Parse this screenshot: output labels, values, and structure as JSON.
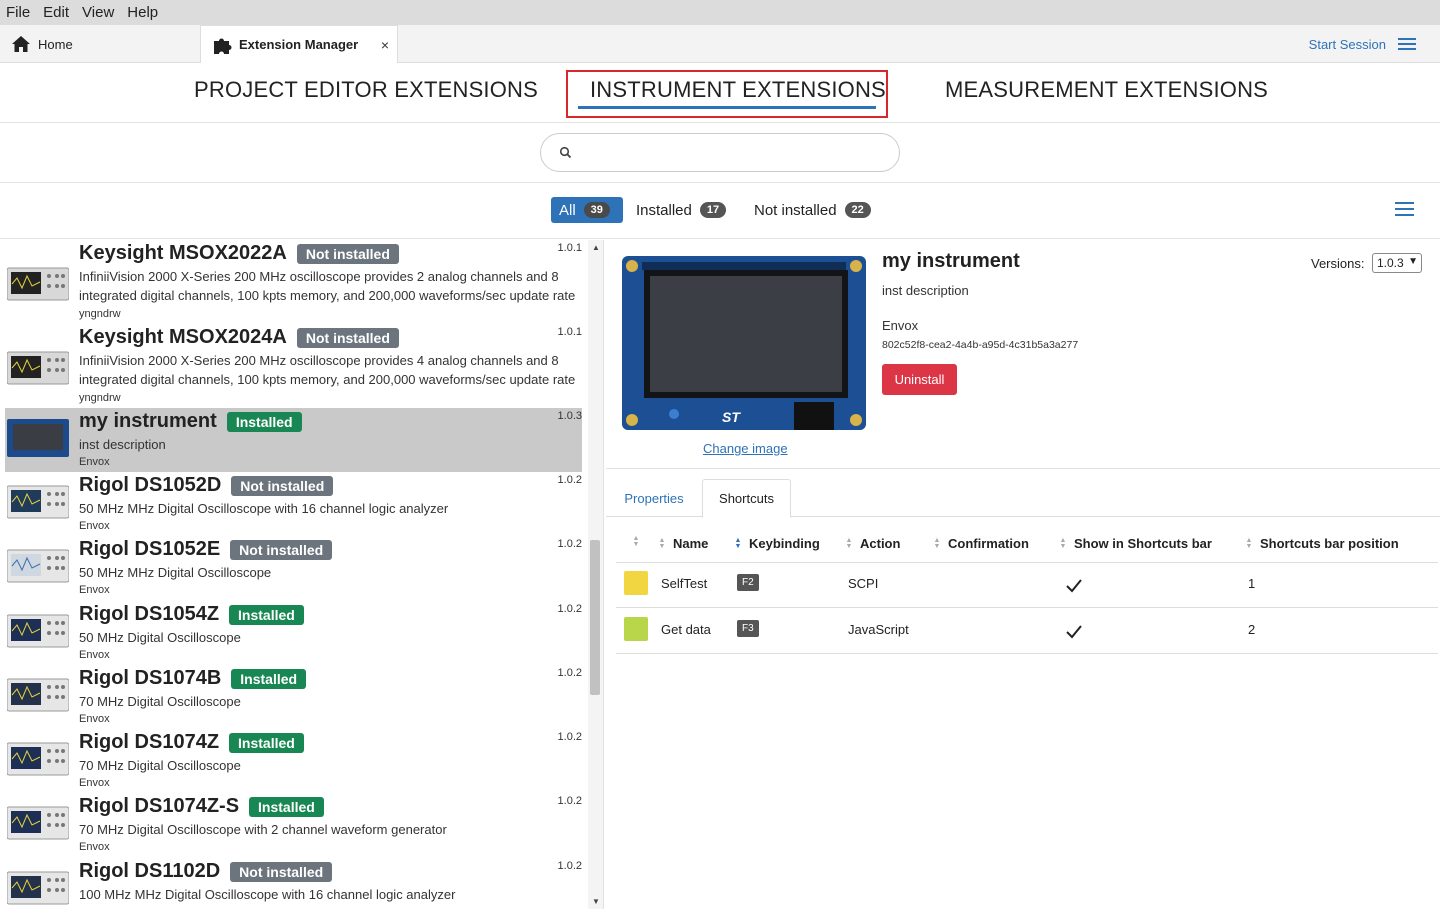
{
  "menu": [
    "File",
    "Edit",
    "View",
    "Help"
  ],
  "tabs": {
    "home_label": "Home",
    "ext_label": "Extension Manager",
    "close_glyph": "×",
    "start_session": "Start Session"
  },
  "sections": {
    "project": "PROJECT EDITOR EXTENSIONS",
    "instrument": "INSTRUMENT EXTENSIONS",
    "measurement": "MEASUREMENT EXTENSIONS",
    "active": "instrument"
  },
  "search": {
    "placeholder": "",
    "value": "",
    "icon": "search-icon"
  },
  "filters": {
    "all_label": "All",
    "all_count": "39",
    "installed_label": "Installed",
    "installed_count": "17",
    "not_installed_label": "Not installed",
    "not_installed_count": "22",
    "active": "all"
  },
  "list": [
    {
      "name": "Keysight MSOX2022A",
      "status": "Not installed",
      "version": "1.0.1",
      "desc": "InfiniiVision 2000 X-Series 200 MHz oscilloscope provides 2 analog channels and 8 integrated digital channels, 100 kpts memory, and 200,000 waveforms/sec update rate",
      "author": "yngndrw"
    },
    {
      "name": "Keysight MSOX2024A",
      "status": "Not installed",
      "version": "1.0.1",
      "desc": "InfiniiVision 2000 X-Series 200 MHz oscilloscope provides 4 analog channels and 8 integrated digital channels, 100 kpts memory, and 200,000 waveforms/sec update rate",
      "author": "yngndrw"
    },
    {
      "name": "my instrument",
      "status": "Installed",
      "version": "1.0.3",
      "desc": "inst description",
      "author": "Envox"
    },
    {
      "name": "Rigol DS1052D",
      "status": "Not installed",
      "version": "1.0.2",
      "desc": "50 MHz MHz Digital Oscilloscope with 16 channel logic analyzer",
      "author": "Envox"
    },
    {
      "name": "Rigol DS1052E",
      "status": "Not installed",
      "version": "1.0.2",
      "desc": "50 MHz MHz Digital Oscilloscope",
      "author": "Envox"
    },
    {
      "name": "Rigol DS1054Z",
      "status": "Installed",
      "version": "1.0.2",
      "desc": "50 MHz Digital Oscilloscope",
      "author": "Envox"
    },
    {
      "name": "Rigol DS1074B",
      "status": "Installed",
      "version": "1.0.2",
      "desc": "70 MHz Digital Oscilloscope",
      "author": "Envox"
    },
    {
      "name": "Rigol DS1074Z",
      "status": "Installed",
      "version": "1.0.2",
      "desc": "70 MHz Digital Oscilloscope",
      "author": "Envox"
    },
    {
      "name": "Rigol DS1074Z-S",
      "status": "Installed",
      "version": "1.0.2",
      "desc": "70 MHz Digital Oscilloscope with 2 channel waveform generator",
      "author": "Envox"
    },
    {
      "name": "Rigol DS1102D",
      "status": "Not installed",
      "version": "1.0.2",
      "desc": "100 MHz MHz Digital Oscilloscope with 16 channel logic analyzer",
      "author": ""
    }
  ],
  "detail": {
    "title": "my instrument",
    "description": "inst description",
    "author": "Envox",
    "id": "802c52f8-cea2-4a4b-a95d-4c31b5a3a277",
    "uninstall_label": "Uninstall",
    "change_image_label": "Change image",
    "versions_label": "Versions:",
    "version_selected": "1.0.3",
    "tabs": {
      "properties": "Properties",
      "shortcuts": "Shortcuts",
      "active": "shortcuts"
    },
    "shortcuts": {
      "headers": [
        "Name",
        "Keybinding",
        "Action",
        "Confirmation",
        "Show in Shortcuts bar",
        "Shortcuts bar position"
      ],
      "sorted_column": "Keybinding",
      "rows": [
        {
          "color": "#f2d641",
          "name": "SelfTest",
          "key": "F2",
          "action": "SCPI",
          "confirmation": "",
          "show_in_bar": true,
          "position": "1"
        },
        {
          "color": "#b9d64a",
          "name": "Get data",
          "key": "F3",
          "action": "JavaScript",
          "confirmation": "",
          "show_in_bar": true,
          "position": "2"
        }
      ]
    }
  },
  "colors": {
    "accent": "#2e73b8",
    "installed": "#198754",
    "not_installed": "#6c757d",
    "danger": "#dc3545",
    "highlight_box": "#d9262a"
  }
}
